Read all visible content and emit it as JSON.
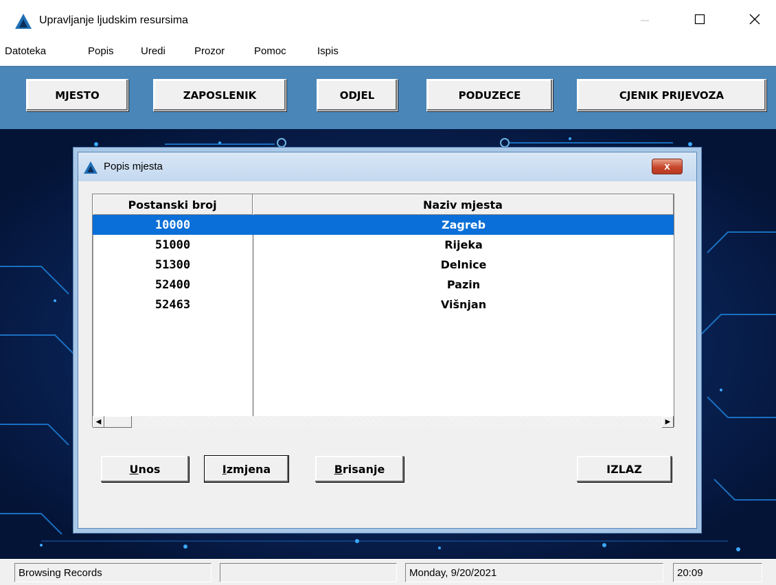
{
  "window": {
    "title": "Upravljanje ljudskim resursima",
    "minimize_icon": "minimize-icon",
    "maximize_icon": "maximize-icon",
    "close_icon": "close-icon"
  },
  "menu": {
    "items": [
      "Datoteka",
      "Popis",
      "Uredi",
      "Prozor",
      "Pomoc",
      "Ispis"
    ]
  },
  "toolbar": {
    "buttons": [
      "MJESTO",
      "ZAPOSLENIK",
      "ODJEL",
      "PODUZECE",
      "CJENIK PRIJEVOZA"
    ]
  },
  "dialog": {
    "title": "Popis mjesta",
    "close_label": "x",
    "grid": {
      "columns": [
        "Postanski broj",
        "Naziv mjesta"
      ],
      "rows": [
        {
          "postal": "10000",
          "name": "Zagreb",
          "selected": true
        },
        {
          "postal": "51000",
          "name": "Rijeka",
          "selected": false
        },
        {
          "postal": "51300",
          "name": "Delnice",
          "selected": false
        },
        {
          "postal": "52400",
          "name": "Pazin",
          "selected": false
        },
        {
          "postal": "52463",
          "name": "Višnjan",
          "selected": false
        }
      ]
    },
    "buttons": {
      "unos": {
        "hotkey": "U",
        "rest": "nos"
      },
      "izmjena": {
        "hotkey": "I",
        "rest": "zmjena"
      },
      "brisanje": {
        "hotkey": "B",
        "rest": "risanje"
      },
      "izlaz": "IZLAZ"
    }
  },
  "statusbar": {
    "mode": "Browsing Records",
    "empty": "",
    "date": "Monday,  9/20/2021",
    "time": "20:09"
  },
  "colors": {
    "toolbar_bg": "#4a86b8",
    "selection": "#0a6fd8",
    "desktop_bg": "#071e52"
  }
}
